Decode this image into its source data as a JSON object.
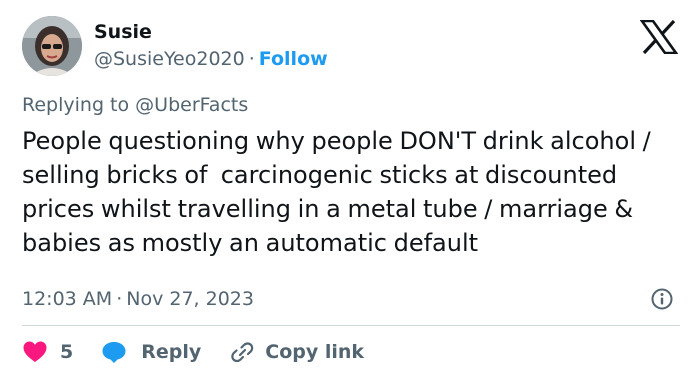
{
  "author": {
    "display_name": "Susie",
    "handle": "@SusieYeo2020",
    "separator": "·",
    "follow_label": "Follow"
  },
  "reply_to": "Replying to @UberFacts",
  "tweet": {
    "text": "People questioning why people DON'T drink alcohol / selling bricks of  carcinogenic sticks at discounted prices whilst travelling in a metal tube / marriage & babies as mostly an automatic default",
    "time": "12:03 AM",
    "date": "Nov 27, 2023",
    "separator": "·"
  },
  "actions": {
    "like_count": "5",
    "reply_label": "Reply",
    "copy_link_label": "Copy link"
  },
  "icons": {
    "like": "heart-icon",
    "reply": "speech-bubble-icon",
    "copy": "link-icon",
    "info": "info-icon",
    "logo": "x-logo-icon"
  },
  "colors": {
    "text": "#0f1419",
    "secondary": "#536471",
    "accent": "#1d9bf0",
    "like": "#f91880",
    "divider": "#cfd9de"
  }
}
